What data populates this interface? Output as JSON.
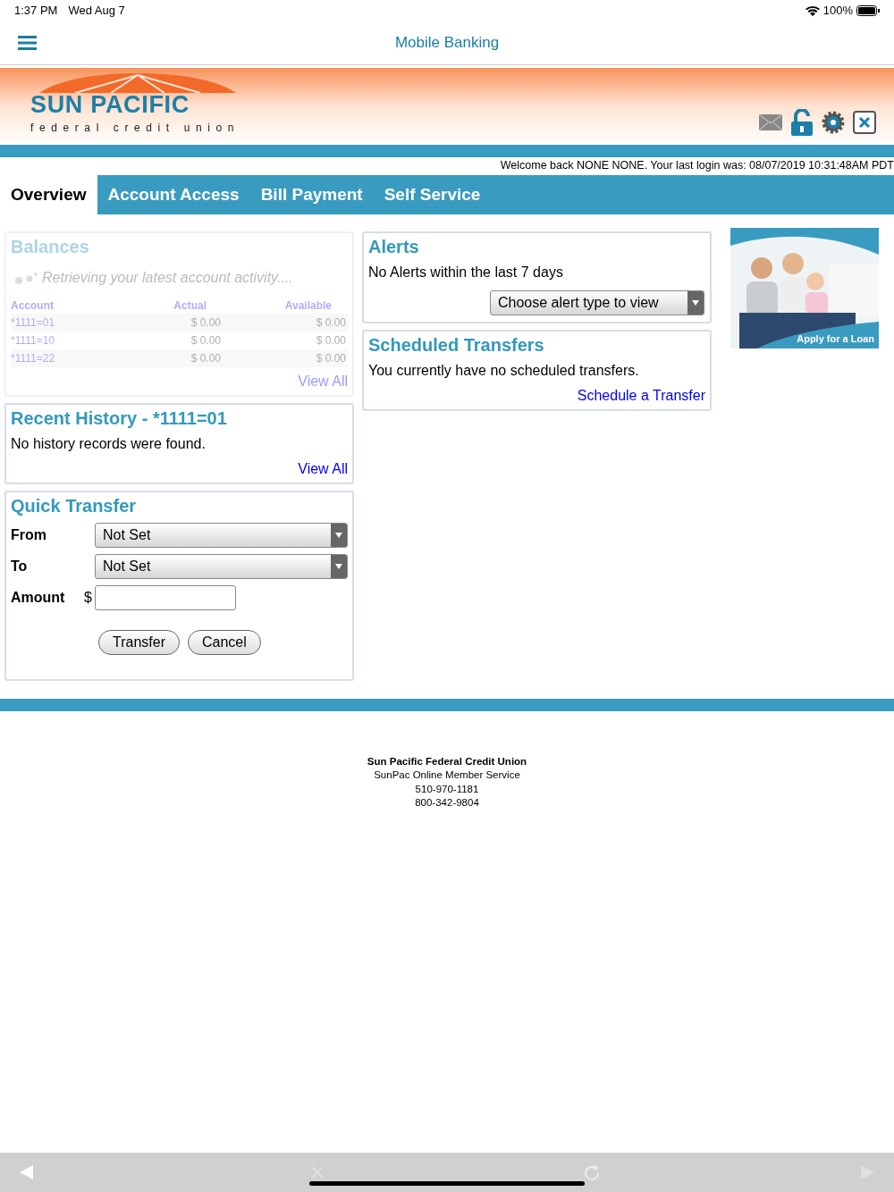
{
  "status_bar": {
    "time": "1:37 PM",
    "date": "Wed Aug 7",
    "battery": "100%"
  },
  "nav_bar": {
    "title": "Mobile Banking"
  },
  "logo": {
    "name": "SUN PACIFIC",
    "tagline": "federal credit union"
  },
  "welcome": "Welcome back NONE NONE. Your last login was: 08/07/2019 10:31:48AM PDT",
  "tabs": [
    {
      "label": "Overview",
      "selected": true
    },
    {
      "label": "Account Access",
      "selected": false
    },
    {
      "label": "Bill Payment",
      "selected": false
    },
    {
      "label": "Self Service",
      "selected": false
    }
  ],
  "balances": {
    "title": "Balances",
    "loading": true,
    "message": "Retrieving your latest account activity....",
    "columns": [
      "Account",
      "Actual",
      "Available"
    ],
    "rows": [
      {
        "account": "*1111=01",
        "actual": "$ 0.00",
        "available": "$ 0.00"
      },
      {
        "account": "*1111=10",
        "actual": "$ 0.00",
        "available": "$ 0.00"
      },
      {
        "account": "*1111=22",
        "actual": "$ 0.00",
        "available": "$ 0.00"
      }
    ],
    "link": "View All"
  },
  "recent_history": {
    "title": "Recent History - *1111=01",
    "message": "No history records were found.",
    "link": "View All"
  },
  "quick_transfer": {
    "title": "Quick Transfer",
    "from_label": "From",
    "from_value": "Not Set",
    "to_label": "To",
    "to_value": "Not Set",
    "amount_label": "Amount",
    "currency": "$",
    "buttons": [
      "Transfer",
      "Cancel"
    ]
  },
  "alerts": {
    "title": "Alerts",
    "message": "No Alerts within the last 7 days",
    "select": "Choose alert type to view"
  },
  "scheduled_transfers": {
    "title": "Scheduled Transfers",
    "message": "You currently have no scheduled transfers.",
    "link": "Schedule a Transfer"
  },
  "ad": {
    "kind": "picture",
    "caption": "Apply for a Loan"
  },
  "footer": {
    "name": "Sun Pacific Federal Credit Union",
    "lines": [
      "SunPac Online Member Service",
      "510-970-1181",
      "800-342-9804"
    ]
  }
}
